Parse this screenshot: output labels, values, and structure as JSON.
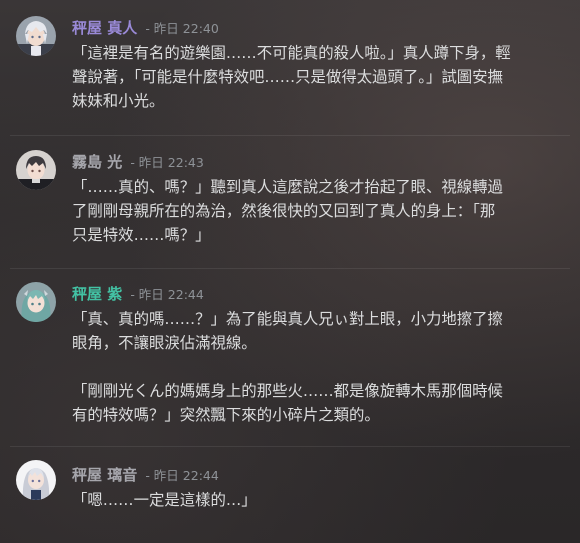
{
  "colors": {
    "name_purple": "#9a8ad8",
    "name_gray": "#a6a6ac",
    "name_teal": "#43c2a4",
    "text": "#dcddde",
    "timestamp": "#8e9297"
  },
  "messages": [
    {
      "author": "秤屋 真人",
      "timestamp": "- 昨日 22:40",
      "avatar_icon": "white-haired-boy-avatar",
      "paragraphs": [
        "「這裡是有名的遊樂園……不可能真的殺人啦。」真人蹲下身，輕",
        "聲說著，「可能是什麼特效吧……只是做得太過頭了。」試圖安撫",
        "妹妹和小光。"
      ]
    },
    {
      "author": "霧島 光",
      "timestamp": "- 昨日 22:43",
      "avatar_icon": "dark-haired-boy-avatar",
      "paragraphs": [
        "「……真的、嗎？」聽到真人這麼說之後才抬起了眼、視線轉過",
        "了剛剛母親所在的為治，然後很快的又回到了真人的身上：「那",
        "只是特效……嗎？」"
      ]
    },
    {
      "author": "秤屋 紫",
      "timestamp": "- 昨日 22:44",
      "avatar_icon": "teal-haired-girl-avatar",
      "paragraphs": [
        "「真、真的嗎……？」為了能與真人兄ぃ對上眼，小力地擦了擦",
        "眼角，不讓眼淚佔滿視線。",
        "「剛剛光くん的媽媽身上的那些火……都是像旋轉木馬那個時候",
        "有的特效嗎？」突然飄下來的小碎片之類的。"
      ]
    },
    {
      "author": "秤屋 璃音",
      "timestamp": "- 昨日 22:44",
      "avatar_icon": "silver-haired-girl-avatar",
      "paragraphs": [
        "「嗯……一定是這樣的…」"
      ]
    }
  ]
}
